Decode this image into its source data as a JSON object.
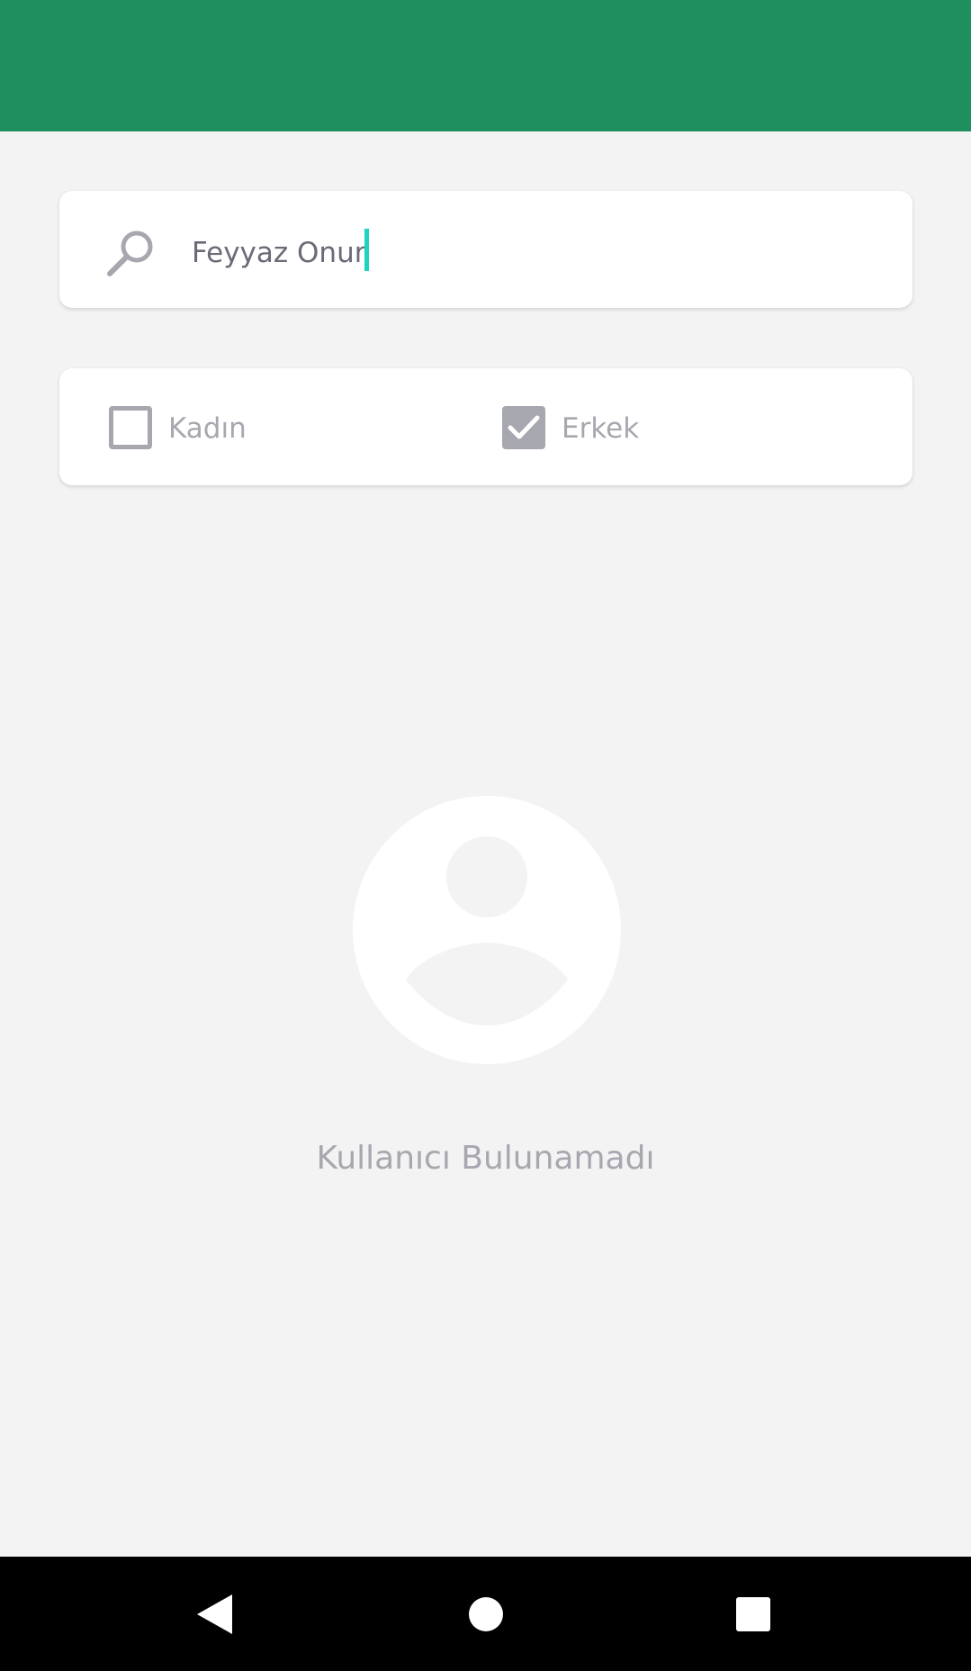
{
  "search": {
    "value": "Feyyaz Onur",
    "icon": "search-icon"
  },
  "filters": {
    "female_label": "Kadın",
    "female_checked": false,
    "male_label": "Erkek",
    "male_checked": true
  },
  "empty_state": {
    "icon": "user-avatar-icon",
    "message": "Kullanıcı Bulunamadı"
  },
  "colors": {
    "app_bar": "#1f8f5f",
    "background": "#f3f3f3",
    "muted_text": "#a7a7b0",
    "caret": "#1ed3c0"
  },
  "nav": {
    "back_icon": "back-triangle-icon",
    "home_icon": "home-circle-icon",
    "recents_icon": "recents-square-icon"
  }
}
